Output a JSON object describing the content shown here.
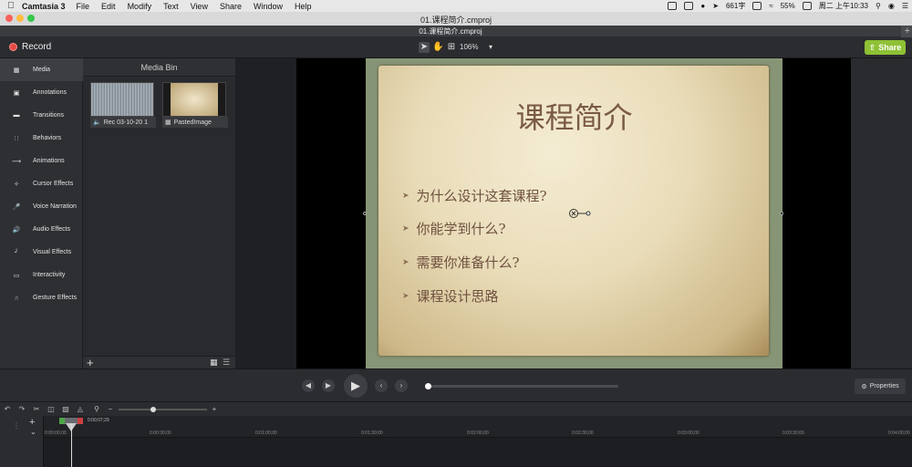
{
  "menubar": {
    "app_name": "Camtasia 3",
    "menus": [
      "File",
      "Edit",
      "Modify",
      "Text",
      "View",
      "Share",
      "Window",
      "Help"
    ],
    "status": {
      "word_count": "661字",
      "battery": "55%",
      "clock": "周二 上午10:33"
    }
  },
  "window": {
    "title": "01.课程简介.cmproj",
    "tab_title": "01.课程简介.cmproj"
  },
  "toolbar": {
    "record_label": "Record",
    "zoom_value": "106%",
    "share_label": "Share"
  },
  "tools": [
    {
      "label": "Media",
      "icon": "film-strip-icon",
      "active": true
    },
    {
      "label": "Annotations",
      "icon": "callout-icon"
    },
    {
      "label": "Transitions",
      "icon": "transition-icon"
    },
    {
      "label": "Behaviors",
      "icon": "behaviors-icon"
    },
    {
      "label": "Animations",
      "icon": "animation-arrow-icon"
    },
    {
      "label": "Cursor Effects",
      "icon": "cursor-effects-icon"
    },
    {
      "label": "Voice Narration",
      "icon": "microphone-icon"
    },
    {
      "label": "Audio Effects",
      "icon": "speaker-icon"
    },
    {
      "label": "Visual Effects",
      "icon": "wand-icon"
    },
    {
      "label": "Interactivity",
      "icon": "interactivity-icon"
    },
    {
      "label": "Gesture Effects",
      "icon": "gesture-hand-icon"
    }
  ],
  "media_bin": {
    "title": "Media Bin",
    "items": [
      {
        "name": "Rec 03-10-20 1",
        "kind": "audio-clip"
      },
      {
        "name": "PastedImage",
        "kind": "image"
      }
    ]
  },
  "slide": {
    "title": "课程简介",
    "bullets": [
      "为什么设计这套课程?",
      "你能学到什么?",
      "需要你准备什么?",
      "课程设计思路"
    ]
  },
  "playback": {
    "properties_label": "Properties",
    "progress": 0
  },
  "timeline": {
    "playhead_time": "0:00:07;29",
    "ticks": [
      "0:00:00;00",
      "0:00:30;00",
      "0:01:00;00",
      "0:01:30;00",
      "0:02:00;00",
      "0:02:30;00",
      "0:03:00;00",
      "0:03:30;00",
      "0:04:00;00"
    ]
  },
  "colors": {
    "share_green": "#8ec135",
    "record_red": "#e34b43",
    "slide_title": "#7a5a44"
  }
}
